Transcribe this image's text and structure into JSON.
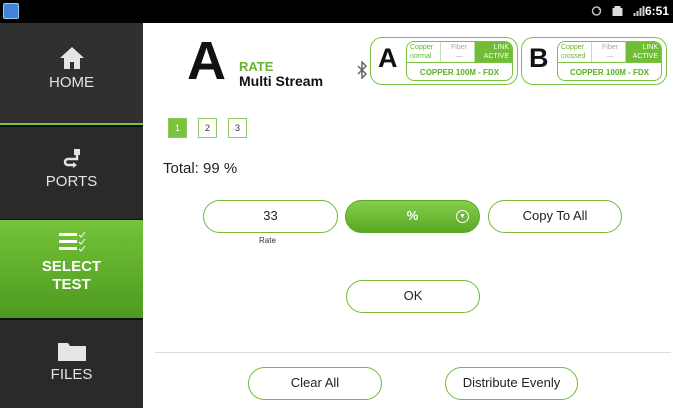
{
  "status_bar": {
    "time": "6:51",
    "icons": [
      "sync-icon",
      "data-icon",
      "signal-icon"
    ]
  },
  "sidebar": {
    "items": [
      {
        "id": "home",
        "label": "HOME",
        "icon": "home-icon"
      },
      {
        "id": "ports",
        "label": "PORTS",
        "icon": "ports-icon"
      },
      {
        "id": "select_test",
        "label_line1": "SELECT",
        "label_line2": "TEST",
        "icon": "list-check-icon",
        "active": true
      },
      {
        "id": "files",
        "label": "FILES",
        "icon": "folder-icon"
      }
    ]
  },
  "header": {
    "port_letter": "A",
    "test_label": "RATE",
    "mode_label": "Multi Stream",
    "bluetooth_icon": "bluetooth-icon"
  },
  "port_a": {
    "letter": "A",
    "media_line1": "Copper",
    "media_line2": "normal",
    "fiber_line1": "Fiber",
    "fiber_line2": "—",
    "link_line1": "LINK",
    "link_line2": "ACTIVE",
    "status": "COPPER 100M  - FDX"
  },
  "port_b": {
    "letter": "B",
    "media_line1": "Copper",
    "media_line2": "crossed",
    "fiber_line1": "Fiber",
    "fiber_line2": "—",
    "link_line1": "LINK",
    "link_line2": "ACTIVE",
    "status": "COPPER 100M  - FDX"
  },
  "streams": {
    "tabs": [
      "1",
      "2",
      "3"
    ],
    "active_index": 0
  },
  "total_text": "Total: 99 %",
  "rate": {
    "value": "33",
    "caption": "Rate",
    "unit": "%"
  },
  "buttons": {
    "copy_to_all": "Copy To All",
    "ok": "OK",
    "clear_all": "Clear All",
    "distribute_evenly": "Distribute Evenly"
  },
  "colors": {
    "accent_green": "#7ac43d",
    "sidebar_bg": "#2a2a2a",
    "statusbar_bg": "#000000"
  }
}
